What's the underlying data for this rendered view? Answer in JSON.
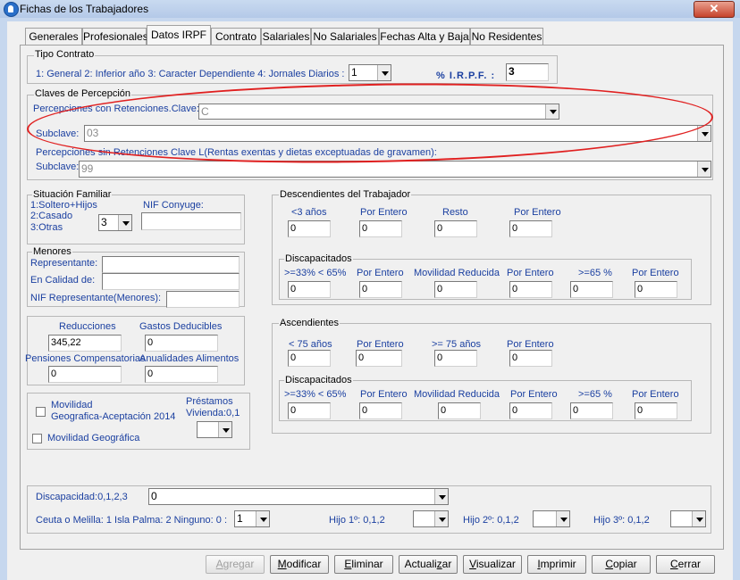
{
  "window": {
    "title": "Fichas de los Trabajadores",
    "close_glyph": "✕",
    "accent": "#c6432b"
  },
  "tabs": [
    {
      "label": "Generales"
    },
    {
      "label": "Profesionales"
    },
    {
      "label": "Datos IRPF"
    },
    {
      "label": "Contrato"
    },
    {
      "label": "Salariales"
    },
    {
      "label": "No Salariales"
    },
    {
      "label": "Fechas Alta y Baja"
    },
    {
      "label": "No Residentes"
    }
  ],
  "active_tab": "Datos IRPF",
  "tipo_contrato": {
    "title": "Tipo Contrato",
    "options_text": "1: General   2: Inferior año  3: Caracter Dependiente    4: Jornales Diarios :",
    "value": "1",
    "irpf_label": "% I.R.P.F. :",
    "irpf_value": "3"
  },
  "claves": {
    "title": "Claves de Percepción",
    "con_ret_label": "Percepciones con Retenciones.Clave:",
    "clave_value": "C",
    "subclave_label": "Subclave:",
    "subclave_value": "03",
    "sin_ret_label": "Percepciones sin Retenciones Clave L(Rentas exentas y dietas exceptuadas de gravamen):",
    "subclave2_label": "Subclave:",
    "subclave2_value": "99"
  },
  "situacion": {
    "title": "Situación Familiar",
    "line1": "1:Soltero+Hijos",
    "line2": "2:Casado",
    "line3": "3:Otras",
    "value": "3",
    "nif_label": "NIF Conyuge:",
    "nif_value": ""
  },
  "menores": {
    "title": "Menores",
    "representante_label": "Representante:",
    "representante_value": "",
    "calidad_label": "En Calidad de:",
    "calidad_value": "",
    "nif_label": "NIF Representante(Menores):",
    "nif_value": ""
  },
  "reducciones": {
    "reducciones_label": "Reducciones",
    "reducciones_value": "345,22",
    "gastos_label": "Gastos Deducibles",
    "gastos_value": "0",
    "pensiones_label": "Pensiones Compensatorias",
    "pensiones_value": "0",
    "anualidades_label": "Anualidades Alimentos",
    "anualidades_value": "0"
  },
  "movilidad": {
    "mov_aceptacion_line1": "Movilidad",
    "mov_aceptacion_line2": "Geografica-Aceptación 2014",
    "mov_geografica": "Movilidad Geográfica",
    "prestamos_line1": "Préstamos",
    "prestamos_line2": "Vivienda:0,1",
    "prestamos_value": ""
  },
  "descendientes": {
    "title": "Descendientes del Trabajador",
    "headers": [
      "<3 años",
      "Por Entero",
      "Resto",
      "Por Entero"
    ],
    "values": [
      "0",
      "0",
      "0",
      "0"
    ],
    "disc_title": "Discapacitados",
    "disc_headers": [
      ">=33% < 65%",
      "Por Entero",
      "Movilidad Reducida",
      "Por Entero",
      ">=65 %",
      "Por Entero"
    ],
    "disc_values": [
      "0",
      "0",
      "0",
      "0",
      "0",
      "0"
    ]
  },
  "ascendientes": {
    "title": "Ascendientes",
    "headers": [
      "< 75 años",
      "Por Entero",
      ">= 75 años",
      "Por Entero"
    ],
    "values": [
      "0",
      "0",
      "0",
      "0"
    ],
    "disc_title": "Discapacitados",
    "disc_headers": [
      ">=33% < 65%",
      "Por Entero",
      "Movilidad Reducida",
      "Por Entero",
      ">=65 %",
      "Por Entero"
    ],
    "disc_values": [
      "0",
      "0",
      "0",
      "0",
      "0",
      "0"
    ]
  },
  "bottom": {
    "discapacidad_label": "Discapacidad:0,1,2,3",
    "discapacidad_value": "0",
    "ceuta_label": "Ceuta o Melilla: 1   Isla Palma: 2   Ninguno: 0 :",
    "ceuta_value": "1",
    "hijo1_label": "Hijo 1º: 0,1,2",
    "hijo1_value": "",
    "hijo2_label": "Hijo 2º: 0,1,2",
    "hijo2_value": "",
    "hijo3_label": "Hijo 3º: 0,1,2",
    "hijo3_value": ""
  },
  "buttons": {
    "agregar": {
      "pre": "",
      "u": "A",
      "post": "gregar"
    },
    "modificar": {
      "pre": "",
      "u": "M",
      "post": "odificar"
    },
    "eliminar": {
      "pre": "",
      "u": "E",
      "post": "liminar"
    },
    "actualizar": {
      "pre": "Actuali",
      "u": "z",
      "post": "ar"
    },
    "visualizar": {
      "pre": "",
      "u": "V",
      "post": "isualizar"
    },
    "imprimir": {
      "pre": "",
      "u": "I",
      "post": "mprimir"
    },
    "copiar": {
      "pre": "",
      "u": "C",
      "post": "opiar"
    },
    "cerrar": {
      "pre": "",
      "u": "C",
      "post": "errar"
    }
  }
}
